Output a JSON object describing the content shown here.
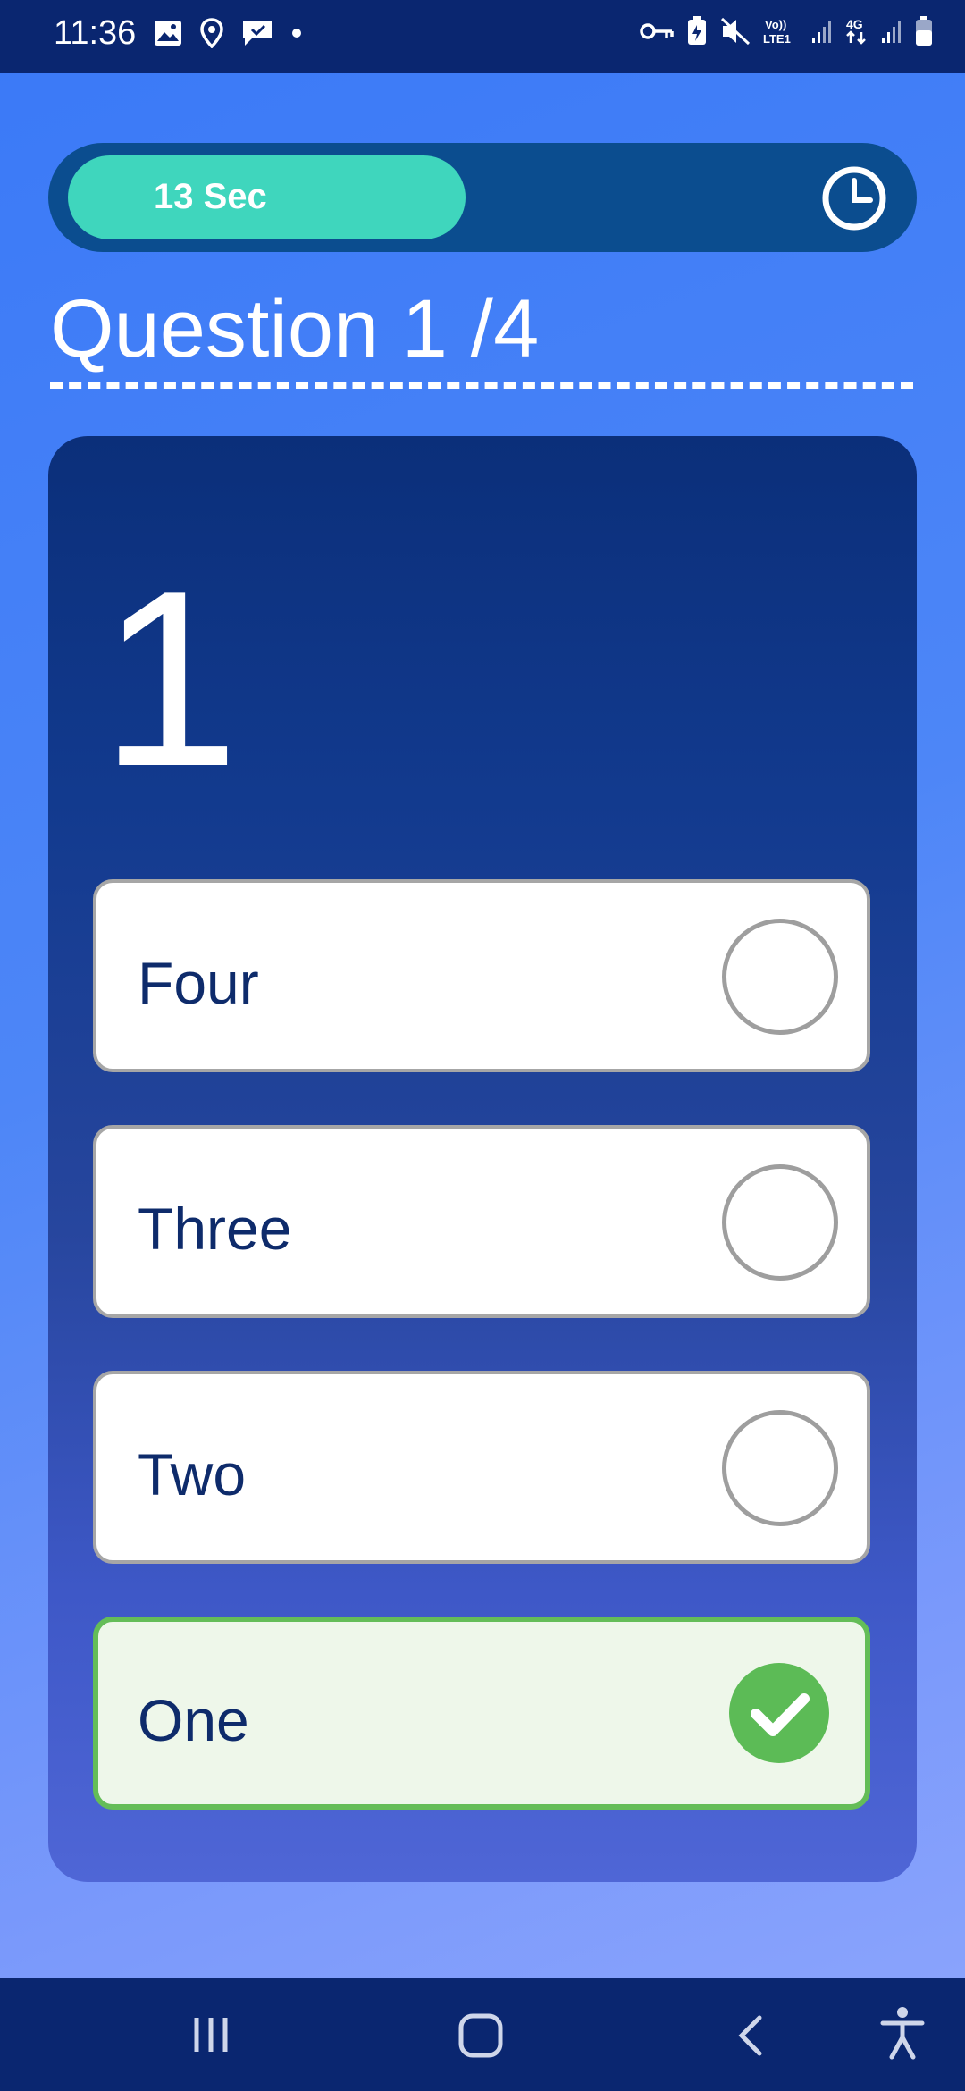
{
  "status_bar": {
    "time": "11:36",
    "left_icons": [
      "image-icon",
      "location-icon",
      "chat-icon",
      "dot-icon"
    ],
    "right_icons": [
      "key-icon",
      "battery-saver-icon",
      "mute-icon",
      "volte-icon",
      "signal-icon",
      "data-4g-icon",
      "signal-icon",
      "battery-icon"
    ]
  },
  "timer": {
    "label": "13 Sec",
    "progress_fraction": 0.48,
    "fill_color": "#3fd6bd",
    "track_color": "#0b4d8f",
    "icon": "clock-icon"
  },
  "question": {
    "title": "Question 1 /4",
    "prompt": "1"
  },
  "options": [
    {
      "label": "Four",
      "selected": false
    },
    {
      "label": "Three",
      "selected": false
    },
    {
      "label": "Two",
      "selected": false
    },
    {
      "label": "One",
      "selected": true
    }
  ],
  "colors": {
    "selected_border": "#64bd58",
    "selected_bg": "#eef7ea",
    "check_green": "#5cbb56",
    "option_text": "#0e2b6b"
  },
  "nav_bar": {
    "buttons": [
      "recents-icon",
      "home-icon",
      "back-icon",
      "accessibility-icon"
    ]
  }
}
